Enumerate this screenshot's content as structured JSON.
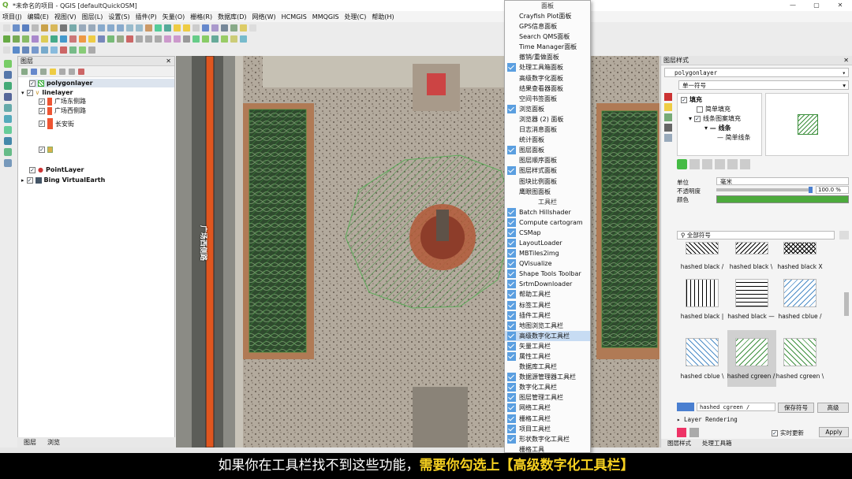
{
  "window": {
    "title": "*未命名的项目 - QGIS [defaultQuickOSM]",
    "min": "—",
    "max": "▢",
    "close": "✕"
  },
  "menu": [
    "项目(J)",
    "编辑(E)",
    "视图(V)",
    "图层(L)",
    "设置(S)",
    "插件(P)",
    "矢量(O)",
    "栅格(R)",
    "数据库(D)",
    "网络(W)",
    "HCMGIS",
    "MMQGIS",
    "处理(C)",
    "帮助(H)"
  ],
  "layers_panel": {
    "title": "图层",
    "tabs": [
      "图层",
      "浏览"
    ],
    "items": [
      {
        "name": "polygonlayer",
        "checked": true
      },
      {
        "name": "linelayer",
        "checked": true
      },
      {
        "name": "广场东侧路",
        "checked": true
      },
      {
        "name": "广场西侧路",
        "checked": true
      },
      {
        "name": "长安街",
        "checked": true
      },
      {
        "name": "PointLayer",
        "checked": true
      },
      {
        "name": "Bing VirtualEarth",
        "checked": true
      }
    ]
  },
  "map": {
    "road_label": "广场西侧路"
  },
  "dropdown": {
    "panels_header": "面板",
    "panels": [
      {
        "label": "Crayfish Plot面板",
        "checked": false
      },
      {
        "label": "GPS信息面板",
        "checked": false
      },
      {
        "label": "Search QMS面板",
        "checked": false
      },
      {
        "label": "Time Manager面板",
        "checked": false
      },
      {
        "label": "撤销/重做面板",
        "checked": false
      },
      {
        "label": "处理工具箱面板",
        "checked": true
      },
      {
        "label": "高级数字化面板",
        "checked": false
      },
      {
        "label": "结果查看器面板",
        "checked": false
      },
      {
        "label": "空间书签面板",
        "checked": false
      },
      {
        "label": "浏览面板",
        "checked": true
      },
      {
        "label": "浏览器 (2) 面板",
        "checked": false
      },
      {
        "label": "日志消息面板",
        "checked": false
      },
      {
        "label": "统计面板",
        "checked": false
      },
      {
        "label": "图层面板",
        "checked": true
      },
      {
        "label": "图层顺序面板",
        "checked": false
      },
      {
        "label": "图层样式面板",
        "checked": true
      },
      {
        "label": "图块比例面板",
        "checked": false
      },
      {
        "label": "鹰眼图面板",
        "checked": false
      }
    ],
    "toolbars_header": "工具栏",
    "toolbars": [
      {
        "label": "Batch Hillshader",
        "checked": true
      },
      {
        "label": "Compute cartogram",
        "checked": true
      },
      {
        "label": "CSMap",
        "checked": true
      },
      {
        "label": "LayoutLoader",
        "checked": true
      },
      {
        "label": "MBTiles2img",
        "checked": true
      },
      {
        "label": "QVisualize",
        "checked": true
      },
      {
        "label": "Shape Tools Toolbar",
        "checked": true
      },
      {
        "label": "SrtmDownloader",
        "checked": true
      },
      {
        "label": "帮助工具栏",
        "checked": true
      },
      {
        "label": "标签工具栏",
        "checked": true
      },
      {
        "label": "插件工具栏",
        "checked": true
      },
      {
        "label": "地图浏览工具栏",
        "checked": true
      },
      {
        "label": "高级数字化工具栏",
        "checked": true,
        "highlight": true
      },
      {
        "label": "矢量工具栏",
        "checked": true
      },
      {
        "label": "属性工具栏",
        "checked": true
      },
      {
        "label": "数据库工具栏",
        "checked": false
      },
      {
        "label": "数据源管理器工具栏",
        "checked": true
      },
      {
        "label": "数字化工具栏",
        "checked": true
      },
      {
        "label": "图层管理工具栏",
        "checked": true
      },
      {
        "label": "网络工具栏",
        "checked": true
      },
      {
        "label": "栅格工具栏",
        "checked": true
      },
      {
        "label": "项目工具栏",
        "checked": true
      },
      {
        "label": "形状数字化工具栏",
        "checked": true
      },
      {
        "label": "栅格工具",
        "checked": false
      }
    ]
  },
  "style_panel": {
    "title": "图层样式",
    "layer_select": "polygonlayer",
    "renderer": "单一符号",
    "tree": [
      "填充",
      "简单填充",
      "线条图案填充",
      "线条",
      "简单线条"
    ],
    "unit_label": "单位",
    "unit_value": "毫米",
    "opacity_label": "不透明度",
    "opacity_value": "100.0 %",
    "color_label": "颜色",
    "symbol_filter": "全部符号",
    "symbols": [
      "hashed black /",
      "hashed black \\",
      "hashed black X",
      "hashed black |",
      "hashed black —",
      "hashed cblue /",
      "hashed cblue \\",
      "hashed cgreen /",
      "hashed cgreen \\"
    ],
    "symbol_name": "hashed cgreen /",
    "save_button": "保存符号",
    "advanced_button": "高级",
    "layer_rendering": "Layer Rendering",
    "live_update": "实时更新",
    "apply_button": "Apply",
    "bottom_tabs": [
      "图层样式",
      "处理工具箱"
    ]
  },
  "caption": {
    "text_normal": "如果你在工具栏找不到这些功能，",
    "text_highlight": "需要你勾选上【高级数字化工具栏】"
  }
}
